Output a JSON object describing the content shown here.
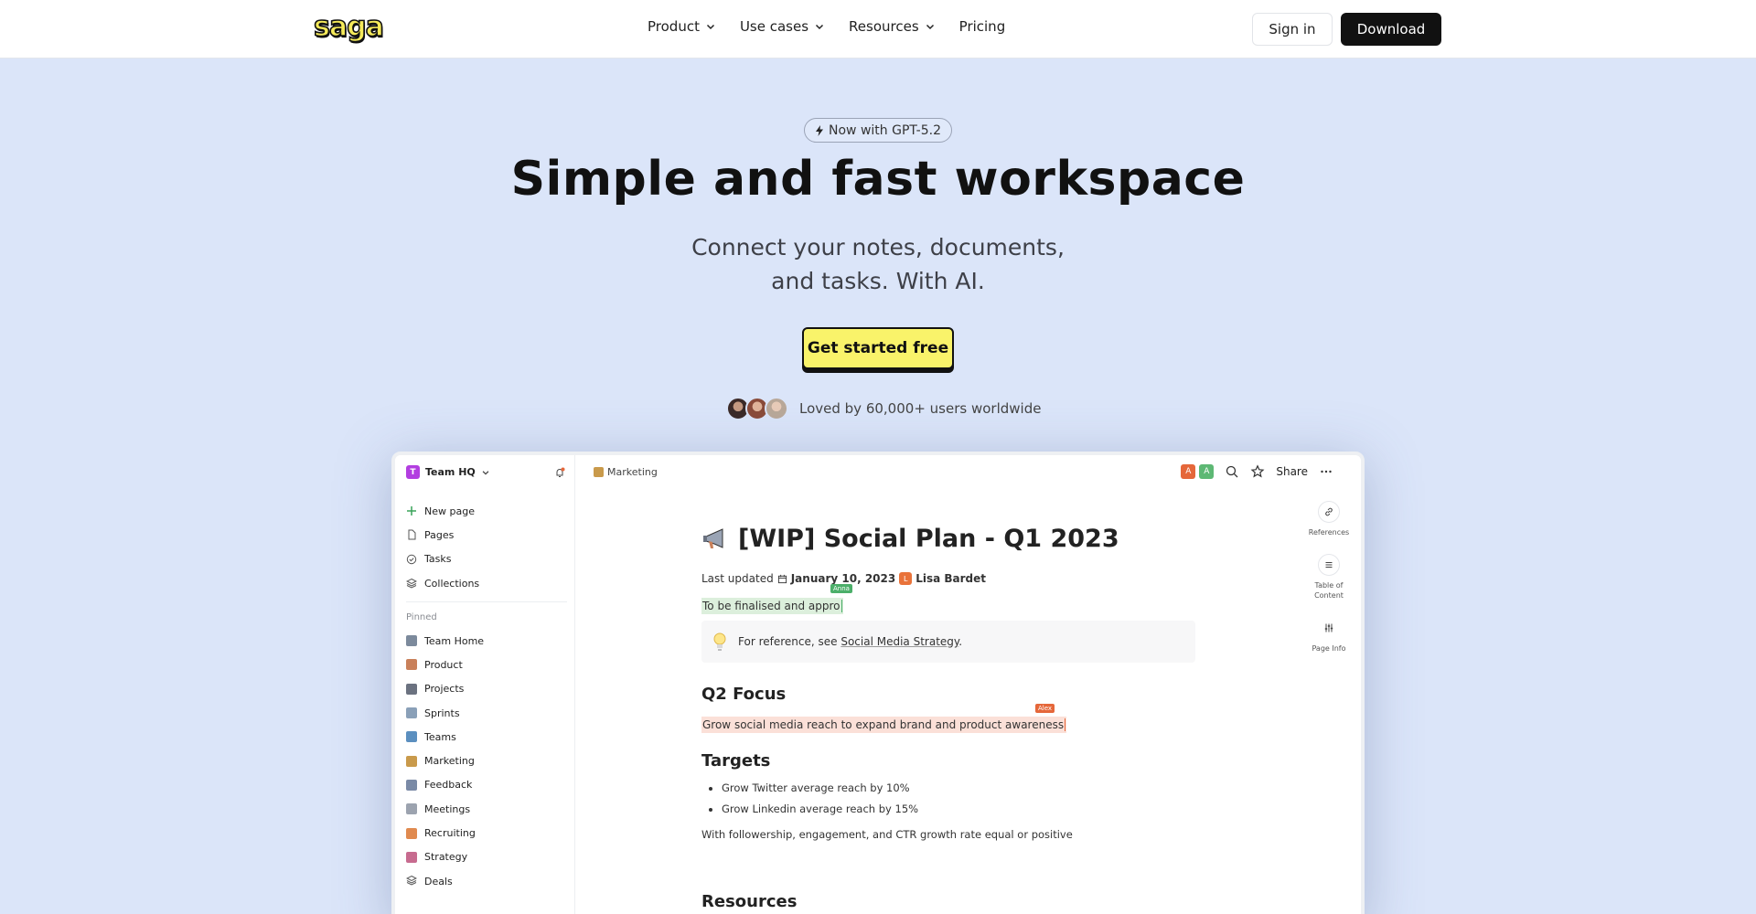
{
  "nav": {
    "logo": "saga",
    "links": [
      {
        "label": "Product",
        "dropdown": true
      },
      {
        "label": "Use cases",
        "dropdown": true
      },
      {
        "label": "Resources",
        "dropdown": true
      },
      {
        "label": "Pricing",
        "dropdown": false
      }
    ],
    "signin": "Sign in",
    "download": "Download"
  },
  "hero": {
    "badge": "Now with GPT-5.2",
    "title": "Simple and fast workspace",
    "subtitle_line1": "Connect your notes, documents,",
    "subtitle_line2": "and tasks. With AI.",
    "cta": "Get started free",
    "loved": "Loved by 60,000+ users worldwide"
  },
  "colors": {
    "background": "#dbe5f9",
    "accent_yellow": "#f9f36a",
    "dark": "#111111"
  },
  "app": {
    "workspace": {
      "initial": "T",
      "name": "Team HQ"
    },
    "sidebar_items": [
      {
        "icon": "plus-icon",
        "label": "New page"
      },
      {
        "icon": "page-icon",
        "label": "Pages"
      },
      {
        "icon": "check-circle-icon",
        "label": "Tasks"
      },
      {
        "icon": "layers-icon",
        "label": "Collections"
      }
    ],
    "pinned_label": "Pinned",
    "pinned": [
      {
        "label": "Team Home",
        "color": "#7c8a9c"
      },
      {
        "label": "Product",
        "color": "#c9805a"
      },
      {
        "label": "Projects",
        "color": "#6b7280"
      },
      {
        "label": "Sprints",
        "color": "#8aa0b8"
      },
      {
        "label": "Teams",
        "color": "#5b8fbf"
      },
      {
        "label": "Marketing",
        "color": "#c99a4b"
      },
      {
        "label": "Feedback",
        "color": "#7a8aa6"
      },
      {
        "label": "Meetings",
        "color": "#9ca3af"
      },
      {
        "label": "Recruiting",
        "color": "#e08a4f"
      },
      {
        "label": "Strategy",
        "color": "#c76b8f"
      },
      {
        "label": "Deals",
        "color": "#555555"
      }
    ],
    "breadcrumb": "Marketing",
    "collaborators": [
      {
        "initial": "A",
        "color": "#e5673a"
      },
      {
        "initial": "A",
        "color": "#5db874"
      }
    ],
    "share": "Share",
    "rail": [
      {
        "icon": "link-icon",
        "label": "References"
      },
      {
        "icon": "list-icon",
        "label": "Table of Content"
      },
      {
        "icon": "sliders-icon",
        "label": "Page Info"
      }
    ],
    "doc": {
      "title": "[WIP] Social Plan - Q1 2023",
      "meta_prefix": "Last updated",
      "date": "January 10, 2023",
      "author_initial": "L",
      "author": "Lisa Bardet",
      "wip_text": "To be finalised and appro",
      "cursor_anna": "Anna",
      "callout_prefix": "For reference, see",
      "callout_link": "Social Media Strategy",
      "callout_suffix": ".",
      "h_focus": "Q2 Focus",
      "goal": "Grow social media reach to expand brand and product awareness",
      "cursor_alex": "Alex",
      "h_targets": "Targets",
      "bullets": [
        "Grow Twitter average reach by 10%",
        "Grow Linkedin average reach by 15%"
      ],
      "note": "With followership, engagement, and CTR growth rate equal or positive",
      "h_resources": "Resources"
    }
  }
}
